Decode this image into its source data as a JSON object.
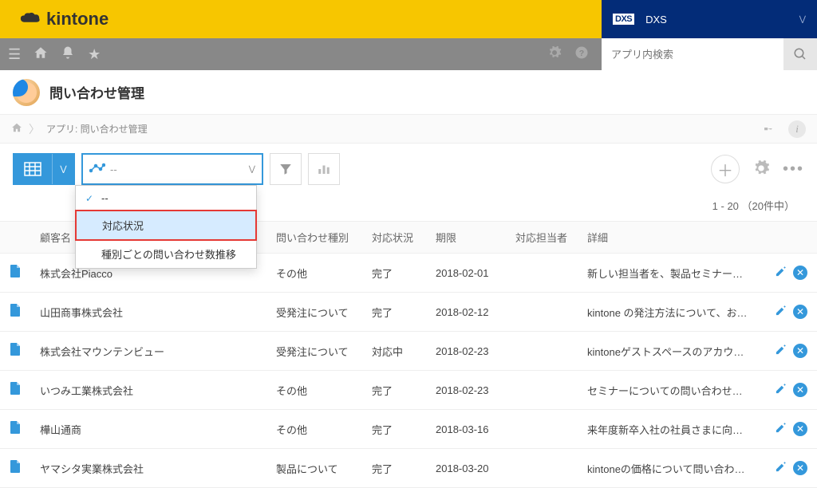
{
  "brand": "kintone",
  "org": {
    "badge": "DXS",
    "name": "DXS"
  },
  "search": {
    "placeholder": "アプリ内検索"
  },
  "app": {
    "title": "問い合わせ管理"
  },
  "breadcrumb": {
    "label": "アプリ: 問い合わせ管理"
  },
  "graph_select": {
    "value": "--"
  },
  "dropdown": {
    "items": [
      {
        "label": "--",
        "checked": true
      },
      {
        "label": "対応状況",
        "highlight": true
      },
      {
        "label": "種別ごとの問い合わせ数推移"
      }
    ]
  },
  "paging": {
    "text": "1 - 20 （20件中）"
  },
  "columns": {
    "customer": "顧客名",
    "type": "問い合わせ種別",
    "status": "対応状況",
    "due": "期限",
    "assignee": "対応担当者",
    "detail": "詳細"
  },
  "rows": [
    {
      "customer": "株式会社Piacco",
      "type": "その他",
      "status": "完了",
      "due": "2018-02-01",
      "assignee": "",
      "detail": "新しい担当者を、製品セミナーに参…"
    },
    {
      "customer": "山田商事株式会社",
      "type": "受発注について",
      "status": "完了",
      "due": "2018-02-12",
      "assignee": "",
      "detail": "kintone の発注方法について、お問…"
    },
    {
      "customer": "株式会社マウンテンビュー",
      "type": "受発注について",
      "status": "対応中",
      "due": "2018-02-23",
      "assignee": "",
      "detail": "kintoneゲストスペースのアカウン…"
    },
    {
      "customer": "いつみ工業株式会社",
      "type": "その他",
      "status": "完了",
      "due": "2018-02-23",
      "assignee": "",
      "detail": "セミナーについての問い合わせ。ki…"
    },
    {
      "customer": "樺山通商",
      "type": "その他",
      "status": "完了",
      "due": "2018-03-16",
      "assignee": "",
      "detail": "来年度新卒入社の社員さまに向けて…"
    },
    {
      "customer": "ヤマシタ実業株式会社",
      "type": "製品について",
      "status": "完了",
      "due": "2018-03-20",
      "assignee": "",
      "detail": "kintoneの価格について問い合わせ…"
    }
  ]
}
